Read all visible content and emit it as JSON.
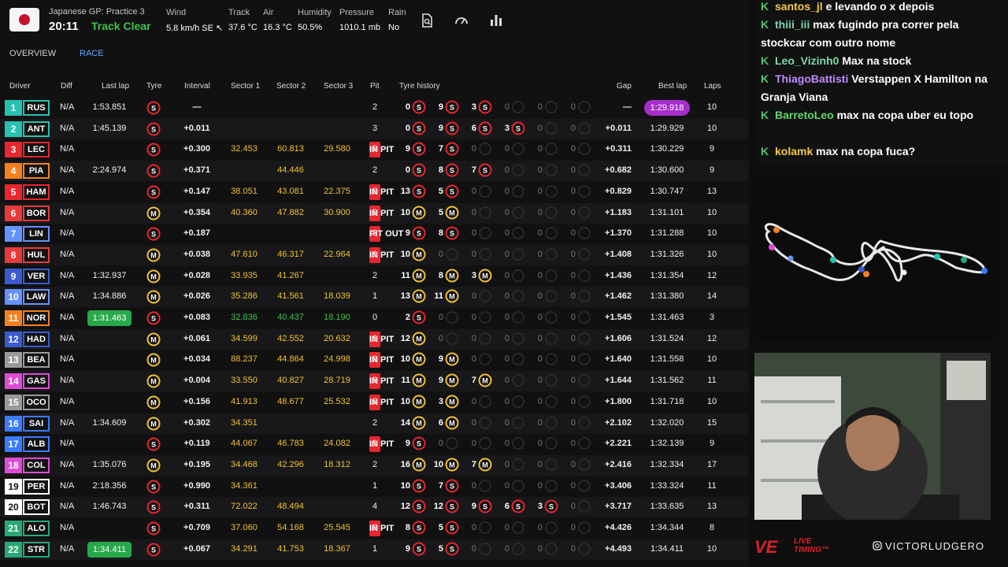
{
  "header": {
    "session_name": "Japanese GP: Practice 3",
    "time": "20:11",
    "track_status": "Track Clear",
    "weather": [
      {
        "label": "Wind",
        "value": "5.8 km/h SE ↖"
      },
      {
        "label": "Track",
        "value": "37.6 °C"
      },
      {
        "label": "Air",
        "value": "16.3 °C"
      },
      {
        "label": "Humidity",
        "value": "50.5%"
      },
      {
        "label": "Pressure",
        "value": "1010.1 mb"
      },
      {
        "label": "Rain",
        "value": "No"
      }
    ]
  },
  "tabs": [
    {
      "label": "OVERVIEW"
    },
    {
      "label": "RACE",
      "active": true
    }
  ],
  "columns": {
    "driver": "Driver",
    "diff": "Diff",
    "last_lap": "Last lap",
    "tyre": "Tyre",
    "interval": "Interval",
    "sector1": "Sector 1",
    "sector2": "Sector 2",
    "sector3": "Sector 3",
    "pit": "Pit",
    "tyre_history": "Tyre history",
    "gap": "Gap",
    "best_lap": "Best lap",
    "laps": "Laps"
  },
  "colors": {
    "soft": "#e8262d",
    "medium": "#f1c232",
    "pit": "#e8262d",
    "purple": "#a62ecb",
    "green": "#27a84a"
  },
  "drivers": [
    {
      "pos": "1",
      "code": "RUS",
      "team": "#27c2b0",
      "diff": "N/A",
      "last": "1:53.851",
      "lt": "",
      "tyre": "S",
      "int": "—",
      "s1": "",
      "s2": "",
      "s3": "",
      "pit": "2",
      "stints": [
        [
          "0",
          "S"
        ],
        [
          "9",
          "S"
        ],
        [
          "3",
          "S"
        ],
        [
          "0",
          ""
        ],
        [
          "0",
          ""
        ],
        [
          "0",
          ""
        ]
      ],
      "gap": "—",
      "best": "1:29.918",
      "bt": "purple",
      "laps": "10"
    },
    {
      "pos": "2",
      "code": "ANT",
      "team": "#27c2b0",
      "diff": "N/A",
      "last": "1:45.139",
      "lt": "",
      "tyre": "S",
      "int": "+0.011",
      "s1": "",
      "s2": "",
      "s3": "",
      "pit": "3",
      "stints": [
        [
          "0",
          "S"
        ],
        [
          "9",
          "S"
        ],
        [
          "6",
          "S"
        ],
        [
          "3",
          "S"
        ],
        [
          "0",
          ""
        ],
        [
          "0",
          ""
        ]
      ],
      "gap": "+0.011",
      "best": "1:29.929",
      "bt": "",
      "laps": "10"
    },
    {
      "pos": "3",
      "code": "LEC",
      "team": "#e8262d",
      "diff": "N/A",
      "last": "IN PIT",
      "lt": "pit",
      "tyre": "S",
      "int": "+0.300",
      "s1": "32.453",
      "s2": "60.813",
      "s3": "29.580",
      "pit": "2",
      "stints": [
        [
          "9",
          "S"
        ],
        [
          "7",
          "S"
        ],
        [
          "0",
          ""
        ],
        [
          "0",
          ""
        ],
        [
          "0",
          ""
        ],
        [
          "0",
          ""
        ]
      ],
      "gap": "+0.311",
      "best": "1:30.229",
      "bt": "",
      "laps": "9"
    },
    {
      "pos": "4",
      "code": "PIA",
      "team": "#f58020",
      "diff": "N/A",
      "last": "2:24.974",
      "lt": "",
      "tyre": "S",
      "int": "+0.371",
      "s1": "",
      "s2": "44.446",
      "s3": "",
      "pit": "2",
      "stints": [
        [
          "0",
          "S"
        ],
        [
          "8",
          "S"
        ],
        [
          "7",
          "S"
        ],
        [
          "0",
          ""
        ],
        [
          "0",
          ""
        ],
        [
          "0",
          ""
        ]
      ],
      "gap": "+0.682",
      "best": "1:30.600",
      "bt": "",
      "laps": "9"
    },
    {
      "pos": "5",
      "code": "HAM",
      "team": "#e8262d",
      "diff": "N/A",
      "last": "IN PIT",
      "lt": "pit",
      "tyre": "S",
      "int": "+0.147",
      "s1": "38.051",
      "s2": "43.081",
      "s3": "22.375",
      "pit": "2",
      "stints": [
        [
          "13",
          "S"
        ],
        [
          "5",
          "S"
        ],
        [
          "0",
          ""
        ],
        [
          "0",
          ""
        ],
        [
          "0",
          ""
        ],
        [
          "0",
          ""
        ]
      ],
      "gap": "+0.829",
      "best": "1:30.747",
      "bt": "",
      "laps": "13"
    },
    {
      "pos": "6",
      "code": "BOR",
      "team": "#e83a3a",
      "diff": "N/A",
      "last": "IN PIT",
      "lt": "pit",
      "tyre": "M",
      "int": "+0.354",
      "s1": "40.360",
      "s2": "47.882",
      "s3": "30.900",
      "pit": "2",
      "stints": [
        [
          "10",
          "M"
        ],
        [
          "5",
          "M"
        ],
        [
          "0",
          ""
        ],
        [
          "0",
          ""
        ],
        [
          "0",
          ""
        ],
        [
          "0",
          ""
        ]
      ],
      "gap": "+1.183",
      "best": "1:31.101",
      "bt": "",
      "laps": "10"
    },
    {
      "pos": "7",
      "code": "LIN",
      "team": "#6692ff",
      "diff": "N/A",
      "last": "PIT OUT",
      "lt": "pit",
      "tyre": "S",
      "int": "+0.187",
      "s1": "",
      "s2": "",
      "s3": "",
      "pit": "2",
      "stints": [
        [
          "9",
          "S"
        ],
        [
          "8",
          "S"
        ],
        [
          "0",
          ""
        ],
        [
          "0",
          ""
        ],
        [
          "0",
          ""
        ],
        [
          "0",
          ""
        ]
      ],
      "gap": "+1.370",
      "best": "1:31.288",
      "bt": "",
      "laps": "10"
    },
    {
      "pos": "8",
      "code": "HUL",
      "team": "#e83a3a",
      "diff": "N/A",
      "last": "IN PIT",
      "lt": "pit",
      "tyre": "M",
      "int": "+0.038",
      "s1": "47.610",
      "s2": "46.317",
      "s3": "22.964",
      "pit": "1",
      "stints": [
        [
          "10",
          "M"
        ],
        [
          "0",
          ""
        ],
        [
          "0",
          ""
        ],
        [
          "0",
          ""
        ],
        [
          "0",
          ""
        ],
        [
          "0",
          ""
        ]
      ],
      "gap": "+1.408",
      "best": "1:31.326",
      "bt": "",
      "laps": "10"
    },
    {
      "pos": "9",
      "code": "VER",
      "team": "#3a5bd0",
      "diff": "N/A",
      "last": "1:32.937",
      "lt": "",
      "tyre": "M",
      "int": "+0.028",
      "s1": "33.935",
      "s2": "41.267",
      "s3": "",
      "pit": "2",
      "stints": [
        [
          "11",
          "M"
        ],
        [
          "8",
          "M"
        ],
        [
          "3",
          "M"
        ],
        [
          "0",
          ""
        ],
        [
          "0",
          ""
        ],
        [
          "0",
          ""
        ]
      ],
      "gap": "+1.436",
      "best": "1:31.354",
      "bt": "",
      "laps": "12"
    },
    {
      "pos": "10",
      "code": "LAW",
      "team": "#6692ff",
      "diff": "N/A",
      "last": "1:34.886",
      "lt": "",
      "tyre": "M",
      "int": "+0.026",
      "s1": "35.286",
      "s2": "41.561",
      "s3": "18.039",
      "pit": "1",
      "stints": [
        [
          "13",
          "M"
        ],
        [
          "11",
          "M"
        ],
        [
          "0",
          ""
        ],
        [
          "0",
          ""
        ],
        [
          "0",
          ""
        ],
        [
          "0",
          ""
        ]
      ],
      "gap": "+1.462",
      "best": "1:31.380",
      "bt": "",
      "laps": "14"
    },
    {
      "pos": "11",
      "code": "NOR",
      "team": "#f58020",
      "diff": "N/A",
      "last": "1:31.463",
      "lt": "best",
      "tyre": "S",
      "int": "+0.083",
      "s1": "32.836",
      "s2": "40.437",
      "s3": "18.190",
      "s1g": true,
      "s2g": true,
      "s3g": true,
      "pit": "0",
      "stints": [
        [
          "2",
          "S"
        ],
        [
          "0",
          ""
        ],
        [
          "0",
          ""
        ],
        [
          "0",
          ""
        ],
        [
          "0",
          ""
        ],
        [
          "0",
          ""
        ]
      ],
      "gap": "+1.545",
      "best": "1:31.463",
      "bt": "",
      "laps": "3"
    },
    {
      "pos": "12",
      "code": "HAD",
      "team": "#3a5bd0",
      "diff": "N/A",
      "last": "IN PIT",
      "lt": "pit",
      "tyre": "M",
      "int": "+0.061",
      "s1": "34.599",
      "s2": "42.552",
      "s3": "20.632",
      "pit": "1",
      "stints": [
        [
          "12",
          "M"
        ],
        [
          "0",
          ""
        ],
        [
          "0",
          ""
        ],
        [
          "0",
          ""
        ],
        [
          "0",
          ""
        ],
        [
          "0",
          ""
        ]
      ],
      "gap": "+1.606",
      "best": "1:31.524",
      "bt": "",
      "laps": "12"
    },
    {
      "pos": "13",
      "code": "BEA",
      "team": "#9a9a9a",
      "diff": "N/A",
      "last": "IN PIT",
      "lt": "pit",
      "tyre": "M",
      "int": "+0.034",
      "s1": "88.237",
      "s2": "44.864",
      "s3": "24.998",
      "pit": "2",
      "stints": [
        [
          "10",
          "M"
        ],
        [
          "9",
          "M"
        ],
        [
          "0",
          ""
        ],
        [
          "0",
          ""
        ],
        [
          "0",
          ""
        ],
        [
          "0",
          ""
        ]
      ],
      "gap": "+1.640",
      "best": "1:31.558",
      "bt": "",
      "laps": "10"
    },
    {
      "pos": "14",
      "code": "GAS",
      "team": "#e04bd6",
      "diff": "N/A",
      "last": "IN PIT",
      "lt": "pit",
      "tyre": "M",
      "int": "+0.004",
      "s1": "33.550",
      "s2": "40.827",
      "s3": "28.719",
      "pit": "3",
      "stints": [
        [
          "11",
          "M"
        ],
        [
          "9",
          "M"
        ],
        [
          "7",
          "M"
        ],
        [
          "0",
          ""
        ],
        [
          "0",
          ""
        ],
        [
          "0",
          ""
        ]
      ],
      "gap": "+1.644",
      "best": "1:31.562",
      "bt": "",
      "laps": "11"
    },
    {
      "pos": "15",
      "code": "OCO",
      "team": "#9a9a9a",
      "diff": "N/A",
      "last": "IN PIT",
      "lt": "pit",
      "tyre": "M",
      "int": "+0.156",
      "s1": "41.913",
      "s2": "48.677",
      "s3": "25.532",
      "pit": "2",
      "stints": [
        [
          "10",
          "M"
        ],
        [
          "3",
          "M"
        ],
        [
          "0",
          ""
        ],
        [
          "0",
          ""
        ],
        [
          "0",
          ""
        ],
        [
          "0",
          ""
        ]
      ],
      "gap": "+1.800",
      "best": "1:31.718",
      "bt": "",
      "laps": "10"
    },
    {
      "pos": "16",
      "code": "SAI",
      "team": "#3a7bff",
      "diff": "N/A",
      "last": "1:34.609",
      "lt": "",
      "tyre": "M",
      "int": "+0.302",
      "s1": "34.351",
      "s2": "",
      "s3": "",
      "pit": "2",
      "stints": [
        [
          "14",
          "M"
        ],
        [
          "6",
          "M"
        ],
        [
          "0",
          ""
        ],
        [
          "0",
          ""
        ],
        [
          "0",
          ""
        ],
        [
          "0",
          ""
        ]
      ],
      "gap": "+2.102",
      "best": "1:32.020",
      "bt": "",
      "laps": "15"
    },
    {
      "pos": "17",
      "code": "ALB",
      "team": "#3a7bff",
      "diff": "N/A",
      "last": "IN PIT",
      "lt": "pit",
      "tyre": "S",
      "int": "+0.119",
      "s1": "44.067",
      "s2": "46.783",
      "s3": "24.082",
      "pit": "1",
      "stints": [
        [
          "9",
          "S"
        ],
        [
          "0",
          ""
        ],
        [
          "0",
          ""
        ],
        [
          "0",
          ""
        ],
        [
          "0",
          ""
        ],
        [
          "0",
          ""
        ]
      ],
      "gap": "+2.221",
      "best": "1:32.139",
      "bt": "",
      "laps": "9"
    },
    {
      "pos": "18",
      "code": "COL",
      "team": "#e04bd6",
      "diff": "N/A",
      "last": "1:35.076",
      "lt": "",
      "tyre": "M",
      "int": "+0.195",
      "s1": "34.468",
      "s2": "42.296",
      "s3": "18.312",
      "pit": "2",
      "stints": [
        [
          "16",
          "M"
        ],
        [
          "10",
          "M"
        ],
        [
          "7",
          "M"
        ],
        [
          "0",
          ""
        ],
        [
          "0",
          ""
        ],
        [
          "0",
          ""
        ]
      ],
      "gap": "+2.416",
      "best": "1:32.334",
      "bt": "",
      "laps": "17"
    },
    {
      "pos": "19",
      "code": "PER",
      "team": "#ffffff",
      "diff": "N/A",
      "last": "2:18.356",
      "lt": "",
      "tyre": "S",
      "int": "+0.990",
      "s1": "34.361",
      "s2": "",
      "s3": "",
      "pit": "1",
      "stints": [
        [
          "10",
          "S"
        ],
        [
          "7",
          "S"
        ],
        [
          "0",
          ""
        ],
        [
          "0",
          ""
        ],
        [
          "0",
          ""
        ],
        [
          "0",
          ""
        ]
      ],
      "gap": "+3.406",
      "best": "1:33.324",
      "bt": "",
      "laps": "11"
    },
    {
      "pos": "20",
      "code": "BOT",
      "team": "#ffffff",
      "diff": "N/A",
      "last": "1:46.743",
      "lt": "",
      "tyre": "S",
      "int": "+0.311",
      "s1": "72.022",
      "s2": "48.494",
      "s3": "",
      "pit": "4",
      "stints": [
        [
          "12",
          "S"
        ],
        [
          "12",
          "S"
        ],
        [
          "9",
          "S"
        ],
        [
          "6",
          "S"
        ],
        [
          "3",
          "S"
        ],
        [
          "0",
          ""
        ]
      ],
      "gap": "+3.717",
      "best": "1:33.635",
      "bt": "",
      "laps": "13"
    },
    {
      "pos": "21",
      "code": "ALO",
      "team": "#2aa876",
      "diff": "N/A",
      "last": "IN PIT",
      "lt": "pit",
      "tyre": "S",
      "int": "+0.709",
      "s1": "37.060",
      "s2": "54.168",
      "s3": "25.545",
      "pit": "2",
      "stints": [
        [
          "8",
          "S"
        ],
        [
          "5",
          "S"
        ],
        [
          "0",
          ""
        ],
        [
          "0",
          ""
        ],
        [
          "0",
          ""
        ],
        [
          "0",
          ""
        ]
      ],
      "gap": "+4.426",
      "best": "1:34.344",
      "bt": "",
      "laps": "8"
    },
    {
      "pos": "22",
      "code": "STR",
      "team": "#2aa876",
      "diff": "N/A",
      "last": "1:34.411",
      "lt": "best",
      "tyre": "S",
      "int": "+0.067",
      "s1": "34.291",
      "s2": "41.753",
      "s3": "18.367",
      "pit": "1",
      "stints": [
        [
          "9",
          "S"
        ],
        [
          "5",
          "S"
        ],
        [
          "0",
          ""
        ],
        [
          "0",
          ""
        ],
        [
          "0",
          ""
        ],
        [
          "0",
          ""
        ]
      ],
      "gap": "+4.493",
      "best": "1:34.411",
      "bt": "",
      "laps": "10"
    }
  ],
  "chat": [
    {
      "user": "santos_jl",
      "text": "e levando o x depois"
    },
    {
      "user": "thiii_iii",
      "text": "max fugindo pra correr pela stockcar com outro nome"
    },
    {
      "user": "Leo_Vizinh0",
      "text": "Max na stock"
    },
    {
      "user": "ThiagoBattisti",
      "text": "Verstappen X Hamilton na Granja Viana"
    },
    {
      "user": "BarretoLeo",
      "text": "max na copa uber eu topo"
    },
    {
      "user": "kolamk",
      "text": "max na copa fuca?"
    }
  ],
  "branding": {
    "logo": "VE",
    "sub1": "LIVE",
    "sub2": "TIMING™",
    "handle": "VICTORLUDGERO"
  }
}
